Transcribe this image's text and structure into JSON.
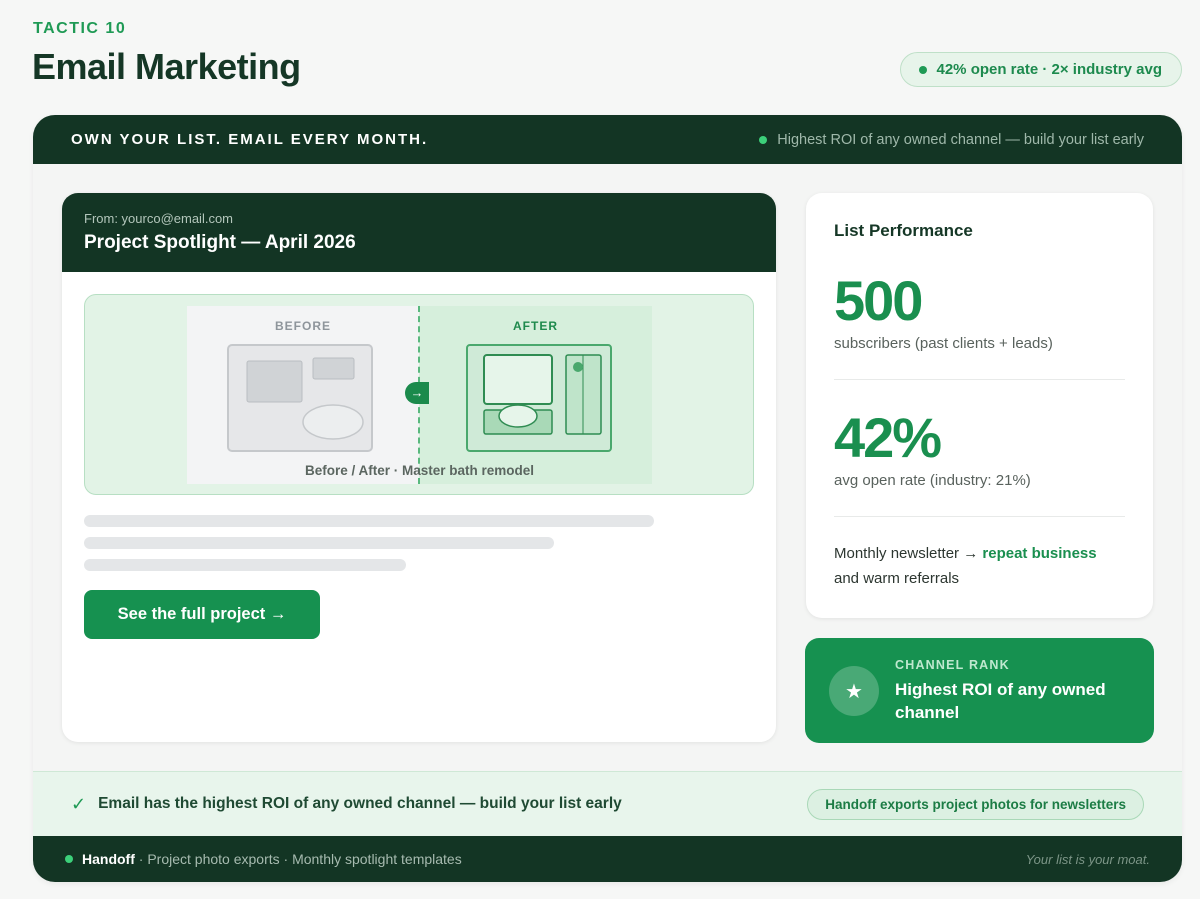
{
  "header": {
    "eyebrow": "TACTIC 10",
    "title": "Email Marketing",
    "stat_pill": "42% open rate · 2× industry avg"
  },
  "banner": {
    "headline": "OWN YOUR LIST. EMAIL EVERY MONTH.",
    "note": "Highest ROI of any owned channel — build your list early"
  },
  "email": {
    "from": "From: yourco@email.com",
    "subject": "Project Spotlight — April 2026",
    "before_label": "BEFORE",
    "after_label": "AFTER",
    "slider_arrow": "→",
    "caption": "Before / After · Master bath remodel",
    "cta_label": "See the full project →"
  },
  "performance": {
    "title": "List Performance",
    "subscribers_value": "500",
    "subscribers_label": "subscribers (past clients + leads)",
    "open_rate_value": "42%",
    "open_rate_label": "avg open rate (industry: 21%)",
    "note_prefix": "Monthly newsletter → ",
    "note_highlight": "repeat business",
    "note_suffix": "and warm referrals"
  },
  "rank": {
    "icon": "star-icon",
    "label": "CHANNEL RANK",
    "text": "Highest ROI of any owned channel"
  },
  "strip": {
    "message": "Email has the highest ROI of any owned channel — build your list early",
    "pill": "Handoff exports project photos for newsletters"
  },
  "footer": {
    "brand": "Handoff",
    "features": "· Project photo exports · Monthly spotlight templates",
    "tagline": "Your list is your moat."
  },
  "colors": {
    "brand_green": "#169150",
    "dark_green": "#133524",
    "accent_light_green": "#3cd07a"
  }
}
